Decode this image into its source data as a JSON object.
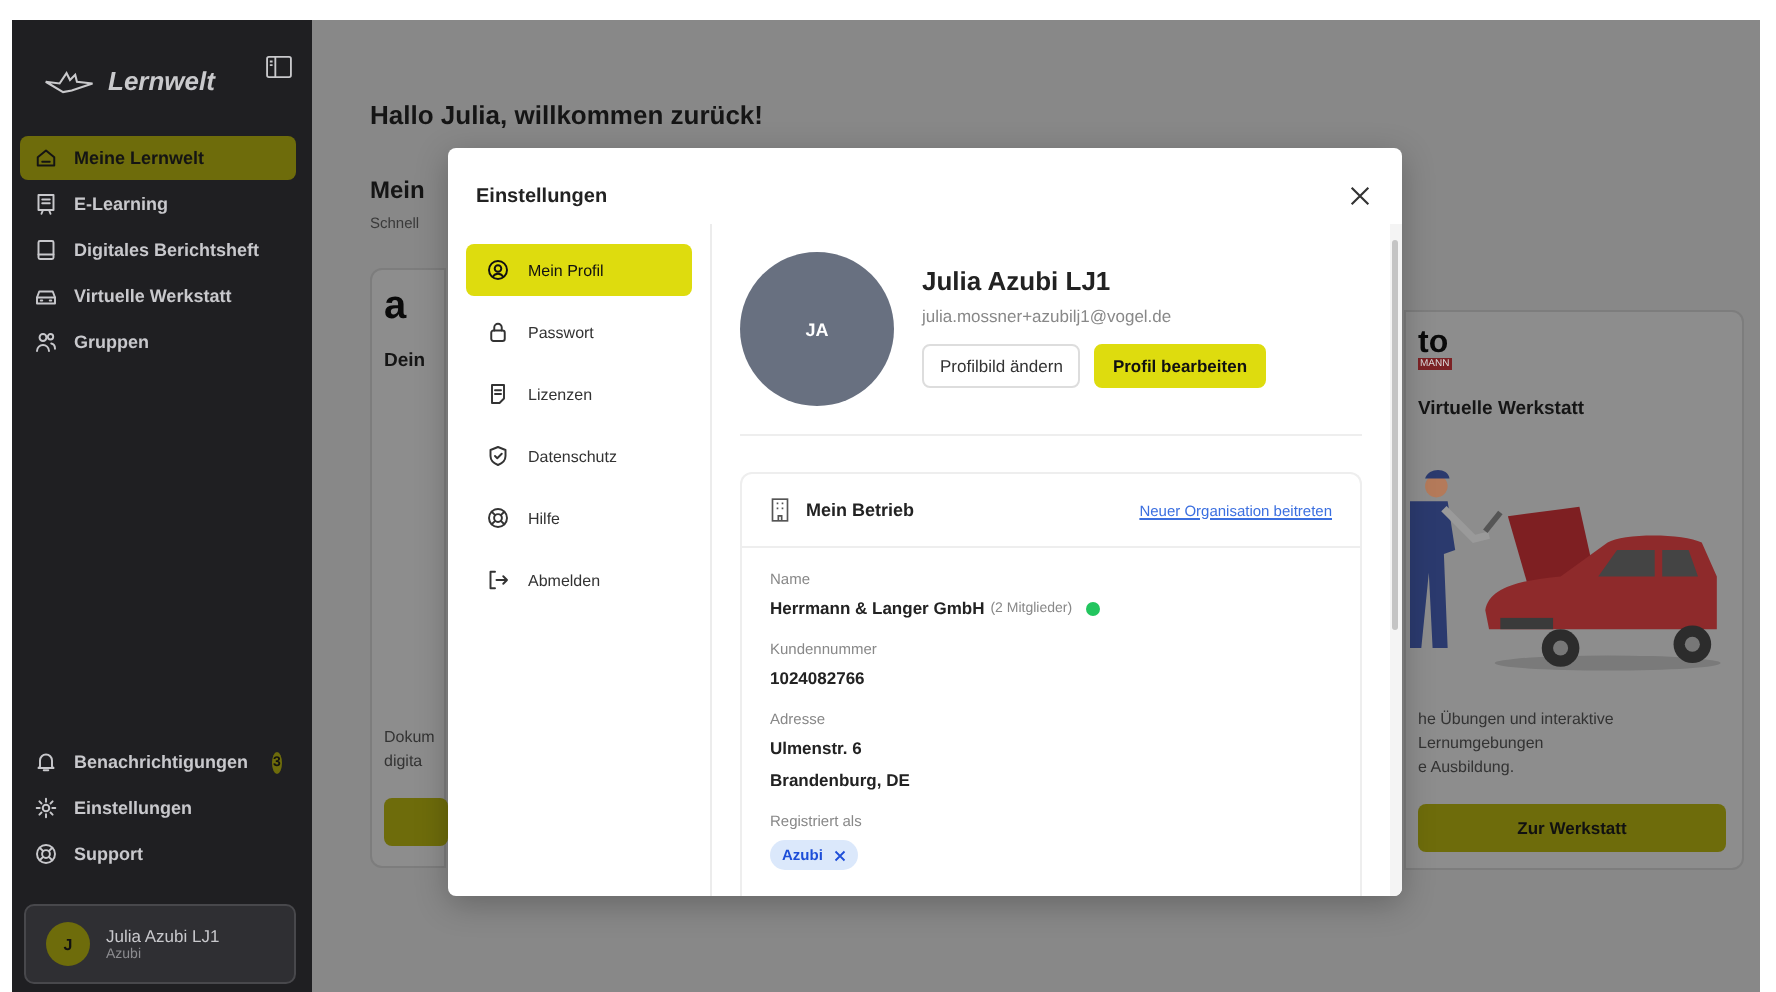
{
  "sidebar": {
    "brand": "Lernwelt",
    "nav": [
      {
        "label": "Meine Lernwelt",
        "selected": true
      },
      {
        "label": "E-Learning",
        "selected": false
      },
      {
        "label": "Digitales Berichtsheft",
        "selected": false
      },
      {
        "label": "Virtuelle Werkstatt",
        "selected": false
      },
      {
        "label": "Gruppen",
        "selected": false
      }
    ],
    "bottom": [
      {
        "label": "Benachrichtigungen",
        "badge": "3"
      },
      {
        "label": "Einstellungen"
      },
      {
        "label": "Support"
      }
    ],
    "user": {
      "initial": "J",
      "name": "Julia Azubi LJ1",
      "role": "Azubi"
    }
  },
  "dashboard": {
    "greeting": "Hallo Julia, willkommen zurück!",
    "section_title": "Mein",
    "section_subtitle": "Schnell",
    "left_card": {
      "logo": "a",
      "title": "Dein",
      "description": [
        "Dokum",
        "digita"
      ]
    },
    "right_card": {
      "logo": "to",
      "logo_sub": "MANN",
      "title": "Virtuelle Werkstatt",
      "description": [
        "he Übungen und interaktive Lernumgebungen",
        "e Ausbildung."
      ],
      "button": "Zur Werkstatt"
    }
  },
  "modal": {
    "title": "Einstellungen",
    "nav": [
      {
        "label": "Mein Profil",
        "selected": true
      },
      {
        "label": "Passwort",
        "selected": false
      },
      {
        "label": "Lizenzen",
        "selected": false
      },
      {
        "label": "Datenschutz",
        "selected": false
      },
      {
        "label": "Hilfe",
        "selected": false
      },
      {
        "label": "Abmelden",
        "selected": false
      }
    ],
    "profile": {
      "initials": "JA",
      "name": "Julia Azubi LJ1",
      "email": "julia.mossner+azubilj1@vogel.de",
      "buttons": [
        {
          "label": "Profilbild ändern",
          "kind": "secondary"
        },
        {
          "label": "Profil bearbeiten",
          "kind": "primary"
        }
      ]
    },
    "company": {
      "title": "Mein Betrieb",
      "link": "Neuer Organisation beitreten",
      "fields": [
        {
          "label": "Name",
          "kind": "status",
          "lines": [
            "Herrmann & Langer GmbH"
          ],
          "note": "(2 Mitglieder)",
          "color": "#22c55e"
        },
        {
          "label": "Kundennummer",
          "kind": "text",
          "lines": [
            "1024082766"
          ]
        },
        {
          "label": "Adresse",
          "kind": "text",
          "lines": [
            "Ulmenstr. 6",
            "Brandenburg, DE"
          ]
        },
        {
          "label": "Registriert als",
          "kind": "chips",
          "chips": [
            "Azubi"
          ]
        }
      ]
    }
  }
}
